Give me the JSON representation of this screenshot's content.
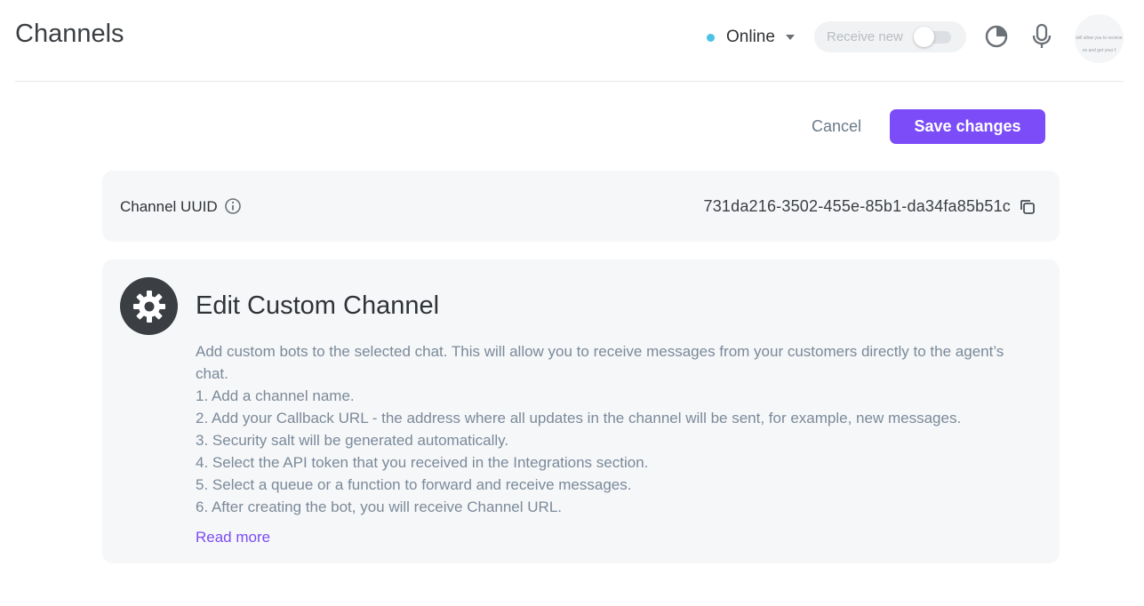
{
  "header": {
    "title": "Channels",
    "status": {
      "label": "Online",
      "dot_color": "#4cc3e6"
    },
    "receive_new": {
      "label": "Receive new",
      "enabled": false
    },
    "icons": [
      "pie-chart-icon",
      "microphone-icon"
    ],
    "avatar_text_top": "will allow you to receive",
    "avatar_text_bottom": "es and get your f"
  },
  "actions": {
    "cancel_label": "Cancel",
    "save_label": "Save changes",
    "accent_color": "#7b4cf7"
  },
  "uuid_card": {
    "label": "Channel UUID",
    "value": "731da216-3502-455e-85b1-da34fa85b51c"
  },
  "info_card": {
    "title": "Edit Custom Channel",
    "intro": "Add custom bots to the selected chat. This will allow you to receive messages from your customers directly to the agent’s chat.",
    "steps": [
      "1. Add a channel name.",
      "2. Add your Callback URL - the address where all updates in the channel will be sent, for example, new messages.",
      "3. Security salt will be generated automatically.",
      "4. Select the API token that you received in the Integrations section.",
      "5. Select a queue or a function to forward and receive messages.",
      "6. After creating the bot, you will receive Channel URL."
    ],
    "read_more": "Read more"
  }
}
